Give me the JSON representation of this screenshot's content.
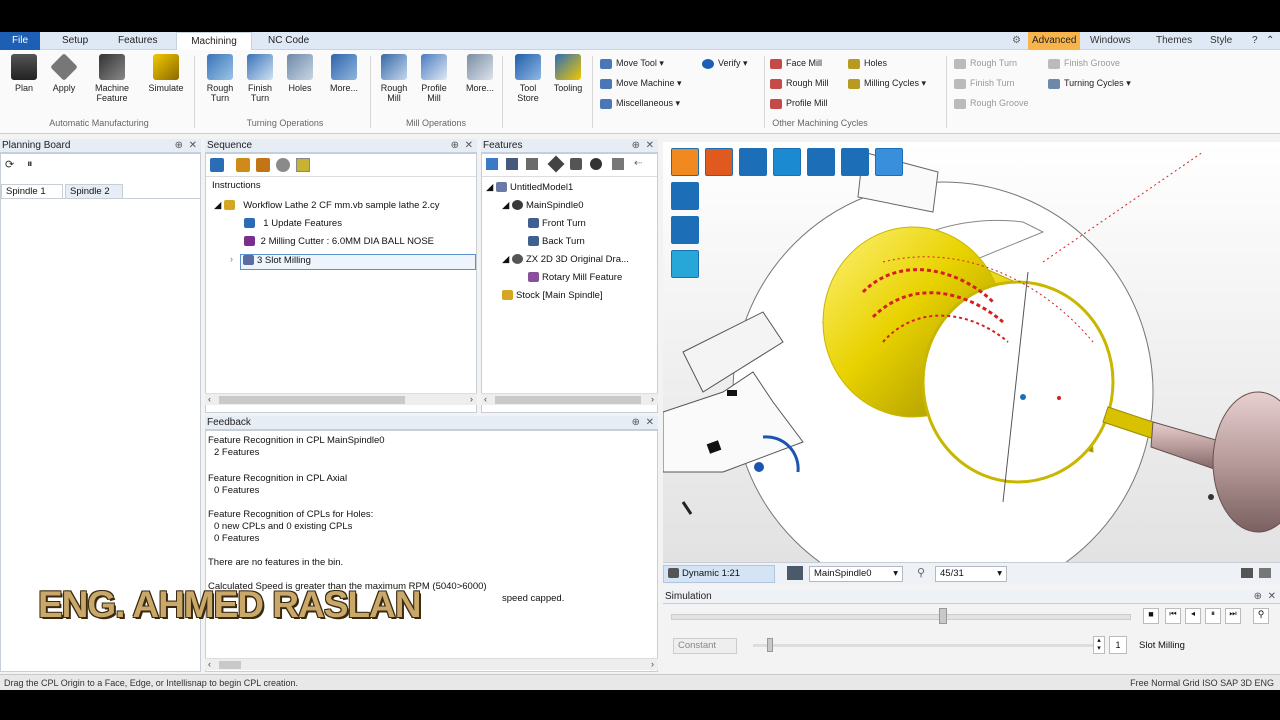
{
  "menubar": {
    "tabs": [
      "File",
      "Setup",
      "Features",
      "Machining",
      "NC Code"
    ],
    "active_tab": "Machining",
    "right_items": [
      "Advanced",
      "Windows",
      "Themes",
      "Style"
    ]
  },
  "ribbon": {
    "large_buttons": [
      {
        "label": "Plan",
        "icon": "plan-icon"
      },
      {
        "label": "Apply",
        "icon": "apply-icon"
      },
      {
        "label": "Machine Feature",
        "icon": "machine-feature-icon"
      },
      {
        "label": "Simulate",
        "icon": "simulate-icon"
      },
      {
        "label": "Rough Turn",
        "icon": "rough-turn-icon"
      },
      {
        "label": "Finish Turn",
        "icon": "finish-turn-icon"
      },
      {
        "label": "Holes",
        "icon": "holes-icon"
      },
      {
        "label": "More...",
        "icon": "more-icon"
      },
      {
        "label": "Rough Mill",
        "icon": "rough-mill-icon"
      },
      {
        "label": "Profile Mill",
        "icon": "profile-mill-icon"
      },
      {
        "label": "More...",
        "icon": "more-icon"
      },
      {
        "label": "Tool Store",
        "icon": "tool-store-icon"
      },
      {
        "label": "Tooling",
        "icon": "tooling-icon"
      }
    ],
    "groups": [
      "Automatic Manufacturing",
      "Turning Operations",
      "Mill Operations",
      "Other Machining Cycles"
    ],
    "small_buttons": {
      "move_tool": "Move Tool",
      "move_machine": "Move Machine",
      "miscellaneous": "Miscellaneous",
      "verify": "Verify",
      "face_mill": "Face Mill",
      "rough_mill": "Rough Mill",
      "profile_mill": "Profile Mill",
      "holes": "Holes",
      "milling_cycles": "Milling Cycles",
      "rough_turn": "Rough Turn",
      "finish_turn": "Finish Turn",
      "rough_groove": "Rough Groove",
      "finish_groove": "Finish Groove",
      "turning_cycles": "Turning Cycles"
    }
  },
  "planning_board": {
    "title": "Planning Board",
    "tabs": [
      "Spindle 1",
      "Spindle 2"
    ]
  },
  "sequence": {
    "title": "Sequence",
    "instructions_label": "Instructions",
    "items": [
      "Workflow Lathe 2 CF mm.vb sample lathe 2.cy",
      "1 Update Features",
      "2 Milling Cutter : 6.0MM DIA BALL NOSE",
      "3 Slot Milling"
    ]
  },
  "features": {
    "title": "Features",
    "tree": [
      "UntitledModel1",
      "MainSpindle0",
      "Front Turn",
      "Back Turn",
      "ZX 2D 3D Original Dra...",
      "Rotary Mill Feature",
      "Stock [Main Spindle]"
    ]
  },
  "feedback": {
    "title": "Feedback",
    "lines": [
      "Feature Recognition in CPL MainSpindle0",
      "  2 Features",
      "Feature Recognition in CPL Axial",
      "  0 Features",
      "Feature Recognition of CPLs for Holes:",
      "  0 new CPLs and   0 existing CPLs",
      "  0 Features",
      "There are no features in the bin.",
      "Calculated Speed is greater than the maximum RPM (5040>6000)",
      "speed capped."
    ]
  },
  "viewport": {
    "view_label": "Dynamic 1:21",
    "spindle_select": "MainSpindle0",
    "zoom_select": "45/31"
  },
  "simulation": {
    "title": "Simulation",
    "constant_label": "Constant",
    "operation_label": "Slot Milling",
    "step_value": "1"
  },
  "statusbar": {
    "hint": "Drag the CPL Origin to a Face, Edge, or Intellisnap to begin CPL creation.",
    "right": "Free  Normal  Grid  ISO  SAP  3D  ENG"
  },
  "watermark": "ENG. AHMED RASLAN",
  "colors": {
    "file_tab": "#1d5fb4",
    "advanced_tab": "#f7b44a",
    "stock_yellow": "#e8d200",
    "toolpath_red": "#d42020",
    "viewport_icon_blue": "#1c6fb7"
  }
}
